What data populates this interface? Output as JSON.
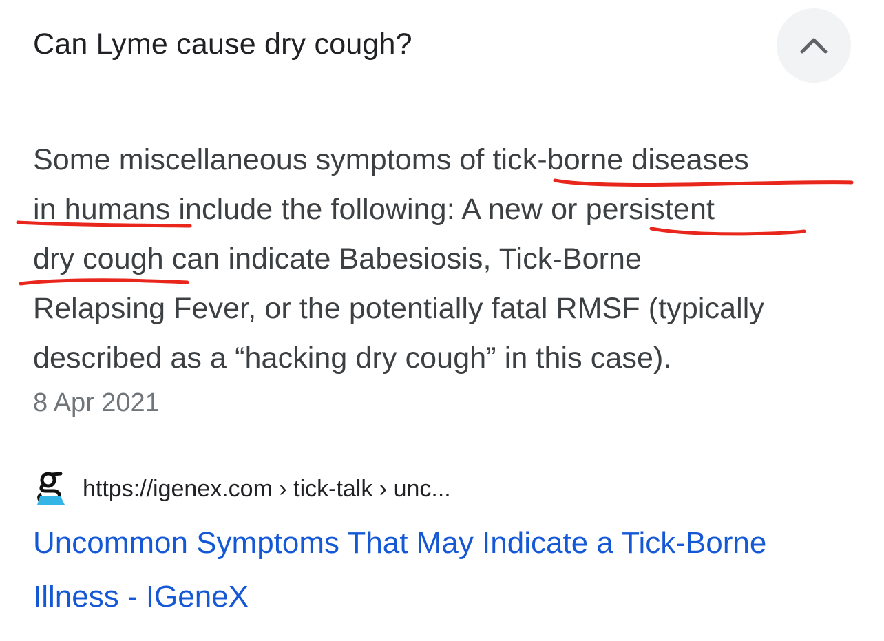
{
  "faq": {
    "question": "Can Lyme cause dry cough?",
    "collapse_icon": "chevron-up-icon",
    "answer_lines": [
      "Some miscellaneous symptoms of tick-borne diseases",
      "in humans include the following: A new or persistent",
      "dry cough can indicate Babesiosis, Tick-Borne",
      "Relapsing Fever, or the potentially fatal RMSF (typically",
      "described as a “hacking dry cough” in this case)."
    ],
    "date": "8 Apr 2021",
    "underline_color": "#e8261c"
  },
  "result": {
    "favicon_icon": "igenex-favicon-icon",
    "url": "https://igenex.com › tick-talk › unc...",
    "title_lines": [
      "Uncommon Symptoms That May Indicate a Tick-Borne",
      "Illness - IGeneX"
    ],
    "link_color": "#1558d6"
  }
}
